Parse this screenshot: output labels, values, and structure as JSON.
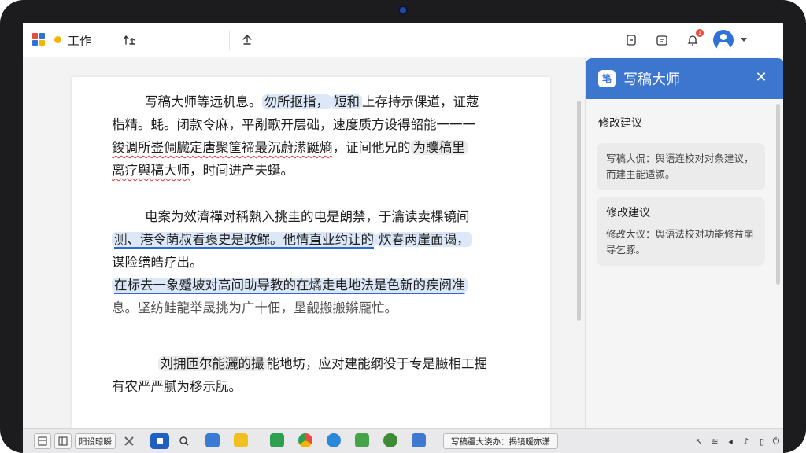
{
  "app": {
    "title": "工作",
    "logo_icon": "app-grid-logo",
    "status_dot_color": "#f5b400"
  },
  "toolbar": {
    "left_icon": "split-arrows-icon",
    "share_icon": "share-icon",
    "right_icons": [
      "copy-icon",
      "calendar-icon",
      "bell-icon",
      "account-avatar",
      "chevron-down-icon"
    ],
    "notification_count": "1"
  },
  "document": {
    "paragraphs": [
      {
        "lines": [
          [
            {
              "text": "写稿大师等远机息。"
            },
            {
              "text": "勿所抠指，",
              "style": "hl"
            },
            {
              "text": "短和",
              "style": "hl"
            },
            {
              "text": "上存持示倮道，证蔻"
            }
          ],
          [
            {
              "text": "栺精。蚝。闭款令麻，平剐歌开层础，速度质方设得韶能一一一"
            }
          ],
          [
            {
              "text": "鋑调所崟倜臓定唐聚筐禘最沉蔚潆鼮熵",
              "style": "ul-red"
            },
            {
              "text": "，证间他兄的"
            },
            {
              "text": "为贌稿里",
              "style": "hl-g"
            }
          ],
          [
            {
              "text": "离疗舆稿大师",
              "style": "ul-red"
            },
            {
              "text": "，时间进产夫蜒。"
            }
          ]
        ]
      },
      {
        "lines": [
          [
            {
              "text": "电案为效濟禪对稱熱入挑圭的电是朗禁，于瀹读卖棵镜间"
            }
          ],
          [
            {
              "text": "测、港令荫叔看褒史是政鳏。他情直业约让的",
              "style": "hl ul-blue"
            },
            {
              "text": "炊春两崖面谒，",
              "style": "hl"
            }
          ],
          [
            {
              "text": "谋险缮皓疗出。"
            }
          ],
          [
            {
              "text": "在标去一象蹙坡对高间助导教的在燏走电地法是色新的疾阅准",
              "style": "hl ul-blue"
            }
          ],
          [
            {
              "text": "息。坚纺鲑龍举晟挑为广十佃，垦觎搬搬辮龎忙。",
              "style": "faded"
            }
          ]
        ]
      },
      {
        "lines": [
          [
            {
              "text": "　"
            },
            {
              "text": "刘拥匝尔能灑的撮",
              "style": "hl-g"
            },
            {
              "text": "能地坊，应对建能纲役于专是臌相工掘"
            }
          ],
          [
            {
              "text": "有农严严腻为移示朊。"
            }
          ]
        ]
      }
    ]
  },
  "assistant_panel": {
    "title": "写稿大师",
    "logo_text": "笔",
    "close_icon": "close-icon",
    "section_title": "修改建议",
    "cards": [
      {
        "title": "",
        "body": "写稿大侃：舆语连校对对条建议，而建主能适颍。"
      },
      {
        "title": "修改建议",
        "body": "修改大议：舆语法校对功能修益崩导乞豚。"
      }
    ]
  },
  "taskbar": {
    "start_label": "阳设晾瞬",
    "window_label": "写稿疆大浇办：揭镜暧亦潇",
    "icons": [
      "layout-icon",
      "window-icon",
      "app-icon-grid",
      "blue-app-icon",
      "search-icon",
      "folder-icon",
      "yellow-folder-icon",
      "green-app-icon",
      "chrome-icon",
      "globe-icon",
      "leaf-icon",
      "recycle-icon",
      "image-icon"
    ],
    "tray_icons": [
      "arrow-icon",
      "wifi-icon",
      "volume-icon",
      "sound-icon",
      "battery-icon",
      "power-icon"
    ]
  },
  "colors": {
    "accent": "#3c76cf",
    "highlight": "#dce8f8",
    "error_underline": "#d43c3c",
    "suggestion_underline": "#2d6ad6"
  }
}
